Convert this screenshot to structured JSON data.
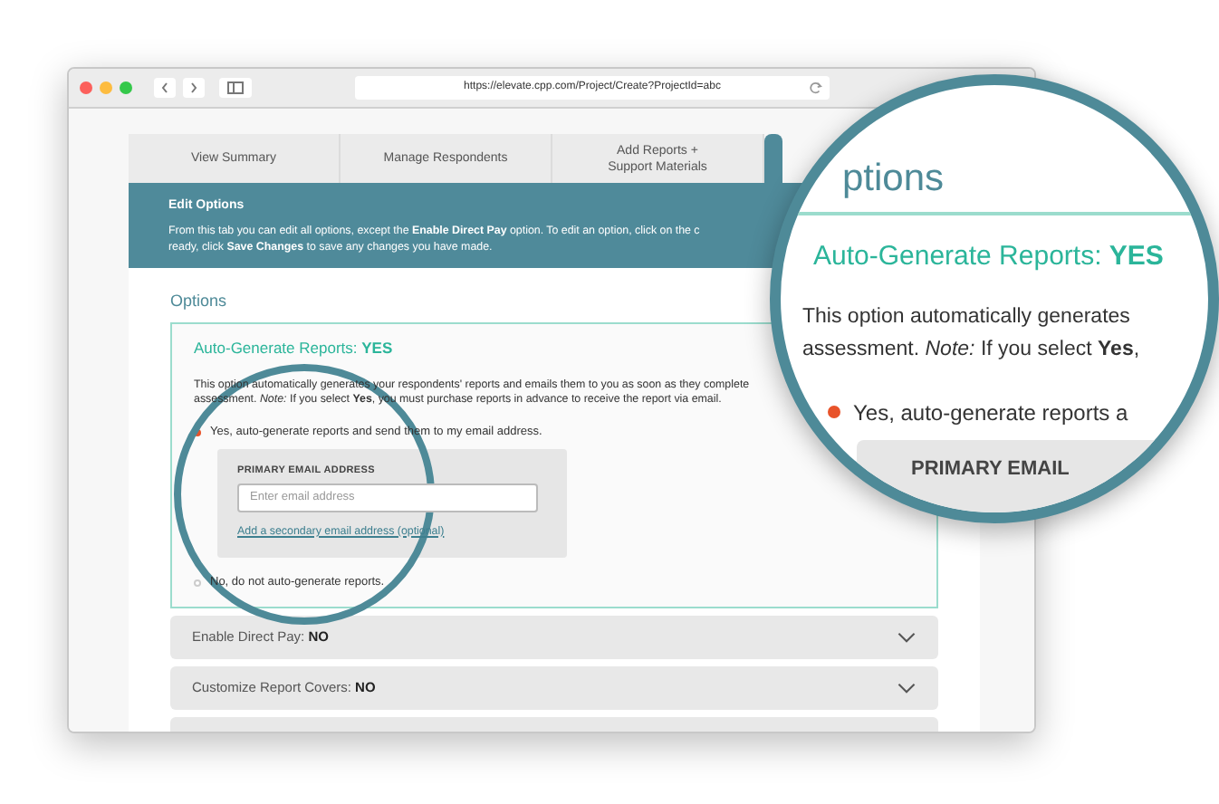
{
  "browser": {
    "url": "https://elevate.cpp.com/Project/Create?ProjectId=abc"
  },
  "tabs": [
    {
      "label": "View Summary",
      "selected": false
    },
    {
      "label": "Manage Respondents",
      "selected": false
    },
    {
      "label": "Add Reports +\nSupport Materials",
      "selected": false
    },
    {
      "selected": true
    }
  ],
  "edit_options": {
    "title": "Edit Options",
    "lines": [
      "From this tab you can edit all options, except the **Enable Direct Pay** option. To edit an option, click on the c",
      "ready, click **Save Changes** to save any changes you have made."
    ]
  },
  "options": {
    "heading": "Options",
    "sections": [
      {
        "title": "Auto-Generate Reports: ",
        "value": "YES",
        "expanded": true,
        "lines": [
          "This option automatically generates your respondents' reports and emails them to you as soon as they complete",
          "assessment. *Note:* If you select **Yes**, you must purchase reports in advance to receive the report via email."
        ],
        "choices": [
          {
            "label": "Yes, auto-generate reports and send them to my email address.",
            "selected": true,
            "email": {
              "label": "PRIMARY EMAIL ADDRESS",
              "placeholder": "Enter email address",
              "link": "Add a secondary email address (optional)"
            }
          },
          {
            "label": "No, do not auto-generate reports.",
            "selected": false
          }
        ]
      },
      {
        "title": "Enable Direct Pay: ",
        "value": "NO",
        "expanded": false
      },
      {
        "title": "Customize Report Covers: ",
        "value": "NO",
        "expanded": false
      },
      {
        "expanded": false
      }
    ]
  },
  "magnifier": {
    "heading": "ptions",
    "title": "Auto-Generate Reports: ",
    "value": "YES",
    "lines": [
      "This option automatically generates",
      "assessment. *Note:* If you select **Yes**,"
    ],
    "choice": {
      "label": "Yes, auto-generate reports a",
      "selected": true
    },
    "email_label": "PRIMARY EMAIL"
  }
}
